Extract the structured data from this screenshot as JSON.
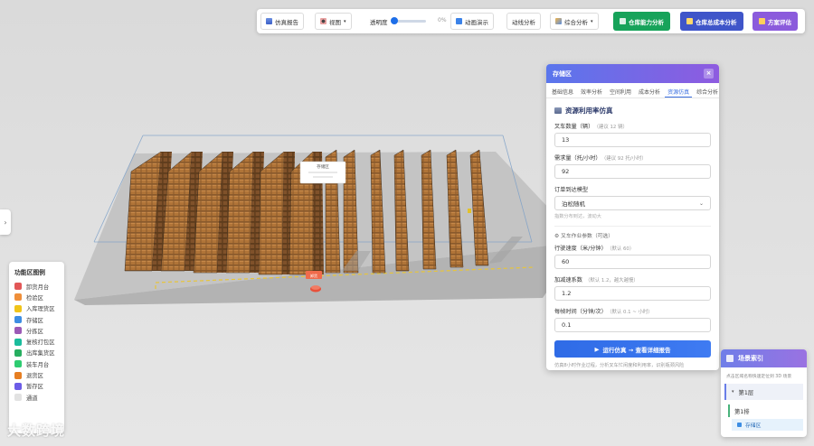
{
  "toolbar": {
    "report": "仿真报告",
    "view": "视图",
    "opacity_label": "透明度",
    "opacity_value": "0%",
    "animation": "动画演示",
    "flow": "动线分析",
    "comprehensive": "综合分析",
    "capacity": "仓库能力分析",
    "cost": "仓库总成本分析",
    "evaluate": "方案评估"
  },
  "legend": {
    "title": "功能区图例",
    "items": [
      {
        "label": "卸货月台",
        "color": "#e25757"
      },
      {
        "label": "检验区",
        "color": "#ef8f3a"
      },
      {
        "label": "入库理货区",
        "color": "#f0c419"
      },
      {
        "label": "存储区",
        "color": "#3d8de3"
      },
      {
        "label": "分拣区",
        "color": "#9b59b6"
      },
      {
        "label": "复核打包区",
        "color": "#1abc9c"
      },
      {
        "label": "出库集货区",
        "color": "#27ae60"
      },
      {
        "label": "装车月台",
        "color": "#2ecc71"
      },
      {
        "label": "退货区",
        "color": "#e67e22"
      },
      {
        "label": "暂存区",
        "color": "#6c5ce7"
      },
      {
        "label": "通道",
        "color": "#e2e2e2"
      }
    ]
  },
  "scene_labels": {
    "popup_title": "存储区",
    "marker": "卸货"
  },
  "watermark": "大数跨境",
  "panel": {
    "title": "存储区",
    "close": "×",
    "tabs": [
      "基础信息",
      "效率分析",
      "空间利用",
      "成本分析",
      "资源仿真",
      "综合分析"
    ],
    "active_tab": 4,
    "section_title": "资源利用率仿真",
    "forklift_label": "叉车数量（辆）",
    "forklift_hint": "（建议 12 辆）",
    "forklift_value": "13",
    "demand_label": "需求量（托/小时）",
    "demand_hint": "（建议 92 托/小时）",
    "demand_value": "92",
    "order_model_label": "订单到达模型",
    "order_model_value": "泊松随机",
    "order_model_note": "指数分布到达，波动大",
    "optional_title": "叉车作业参数（可选）",
    "speed_label": "行驶速度（米/分钟）",
    "speed_hint": "（默认 60）",
    "speed_value": "60",
    "accel_label": "加减速系数",
    "accel_hint": "（默认 1.2，越大越慢）",
    "accel_value": "1.2",
    "hold_label": "每帧时间（分钟/次）",
    "hold_hint": "（默认 0.1 ~ 小时）",
    "hold_value": "0.1",
    "run_button": "运行仿真 → 查看详细报告",
    "foot_note": "仿真8小时作业过程，分析叉车忙闲度和利用率，识别瓶颈风险"
  },
  "scene_index": {
    "title": "场景索引",
    "desc": "点击区域名称快速定位到 3D 场景",
    "level1": "第1层",
    "level2": "第1排",
    "level3": "存储区"
  }
}
